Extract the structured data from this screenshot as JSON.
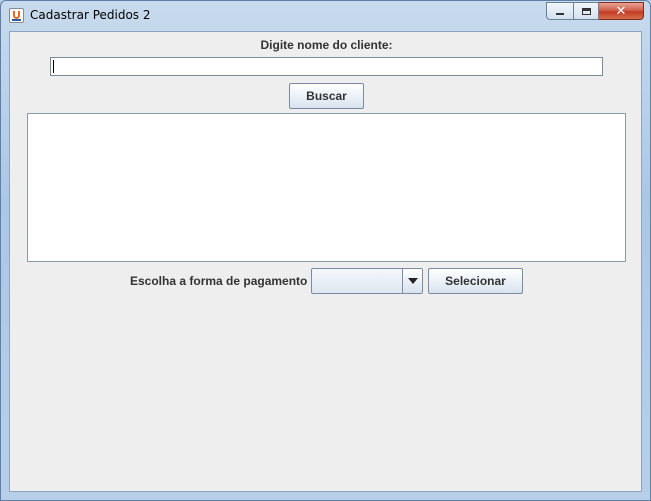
{
  "window": {
    "title": "Cadastrar Pedidos 2",
    "controls": {
      "minimize": "—",
      "maximize": "□",
      "close": "✕"
    }
  },
  "form": {
    "client_label": "Digite nome do cliente:",
    "client_input_value": "",
    "search_button": "Buscar",
    "results_items": [],
    "payment_label": "Escolha a forma de pagamento",
    "payment_selected": "",
    "select_button": "Selecionar"
  },
  "icons": {
    "app": "java-cup-icon",
    "dropdown": "triangle-down-icon"
  },
  "colors": {
    "panel_bg": "#eeeeee",
    "close_button": "#c23c23",
    "title_bar": "#aac7e6"
  }
}
